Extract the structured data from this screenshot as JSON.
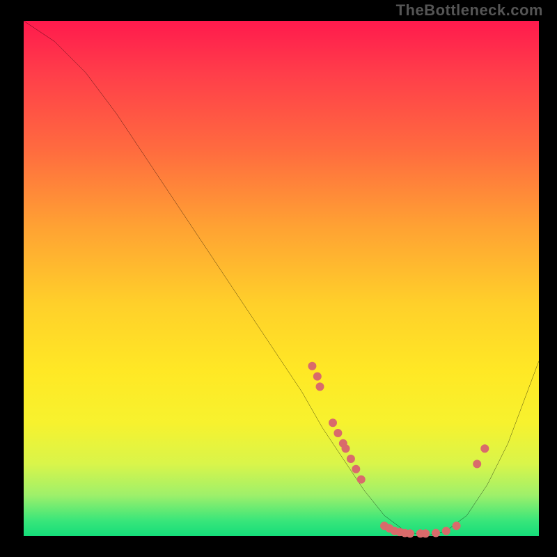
{
  "watermark": "TheBottleneck.com",
  "chart_data": {
    "type": "line",
    "title": "",
    "xlabel": "",
    "ylabel": "",
    "xlim": [
      0,
      100
    ],
    "ylim": [
      0,
      100
    ],
    "grid": false,
    "legend": false,
    "series": [
      {
        "name": "curve",
        "x": [
          0,
          6,
          12,
          18,
          24,
          30,
          36,
          42,
          48,
          54,
          58,
          62,
          66,
          70,
          74,
          78,
          82,
          86,
          90,
          94,
          100
        ],
        "y": [
          100,
          96,
          90,
          82,
          73,
          64,
          55,
          46,
          37,
          28,
          21,
          15,
          9,
          4,
          1,
          0,
          1,
          4,
          10,
          18,
          34
        ],
        "color": "#000000"
      }
    ],
    "points": [
      {
        "x": 56,
        "y": 33,
        "r": 6,
        "color": "#d96b6b"
      },
      {
        "x": 57,
        "y": 31,
        "r": 6,
        "color": "#d96b6b"
      },
      {
        "x": 57.5,
        "y": 29,
        "r": 6,
        "color": "#d96b6b"
      },
      {
        "x": 60,
        "y": 22,
        "r": 6,
        "color": "#d96b6b"
      },
      {
        "x": 61,
        "y": 20,
        "r": 6,
        "color": "#d96b6b"
      },
      {
        "x": 62,
        "y": 18,
        "r": 6,
        "color": "#d96b6b"
      },
      {
        "x": 62.5,
        "y": 17,
        "r": 6,
        "color": "#d96b6b"
      },
      {
        "x": 63.5,
        "y": 15,
        "r": 6,
        "color": "#d96b6b"
      },
      {
        "x": 64.5,
        "y": 13,
        "r": 6,
        "color": "#d96b6b"
      },
      {
        "x": 65.5,
        "y": 11,
        "r": 6,
        "color": "#d96b6b"
      },
      {
        "x": 70,
        "y": 2,
        "r": 6,
        "color": "#d96b6b"
      },
      {
        "x": 71,
        "y": 1.5,
        "r": 6,
        "color": "#d96b6b"
      },
      {
        "x": 72,
        "y": 1,
        "r": 6,
        "color": "#d96b6b"
      },
      {
        "x": 73,
        "y": 0.8,
        "r": 6,
        "color": "#d96b6b"
      },
      {
        "x": 74,
        "y": 0.6,
        "r": 6,
        "color": "#d96b6b"
      },
      {
        "x": 75,
        "y": 0.5,
        "r": 6,
        "color": "#d96b6b"
      },
      {
        "x": 77,
        "y": 0.5,
        "r": 6,
        "color": "#d96b6b"
      },
      {
        "x": 78,
        "y": 0.5,
        "r": 6,
        "color": "#d96b6b"
      },
      {
        "x": 80,
        "y": 0.6,
        "r": 6,
        "color": "#d96b6b"
      },
      {
        "x": 82,
        "y": 1,
        "r": 6,
        "color": "#d96b6b"
      },
      {
        "x": 84,
        "y": 2,
        "r": 6,
        "color": "#d96b6b"
      },
      {
        "x": 88,
        "y": 14,
        "r": 6,
        "color": "#d96b6b"
      },
      {
        "x": 89.5,
        "y": 17,
        "r": 6,
        "color": "#d96b6b"
      }
    ]
  }
}
